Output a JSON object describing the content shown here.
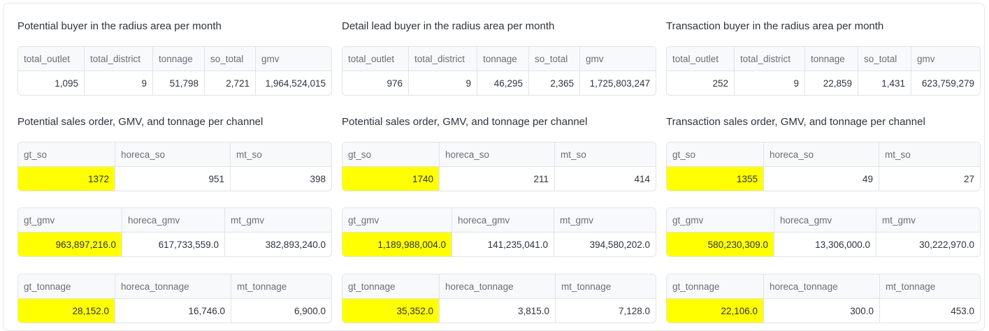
{
  "sections": [
    {
      "summary": {
        "title": "Potential buyer in the radius area per month",
        "headers": [
          "total_outlet",
          "total_district",
          "tonnage",
          "so_total",
          "gmv"
        ],
        "values": [
          "1,095",
          "9",
          "51,798",
          "2,721",
          "1,964,524,015"
        ]
      },
      "channel_title": "Potential sales order, GMV, and tonnage per channel",
      "so": {
        "headers": [
          "gt_so",
          "horeca_so",
          "mt_so"
        ],
        "values": [
          "1372",
          "951",
          "398"
        ]
      },
      "gmv": {
        "headers": [
          "gt_gmv",
          "horeca_gmv",
          "mt_gmv"
        ],
        "values": [
          "963,897,216.0",
          "617,733,559.0",
          "382,893,240.0"
        ]
      },
      "tonnage": {
        "headers": [
          "gt_tonnage",
          "horeca_tonnage",
          "mt_tonnage"
        ],
        "values": [
          "28,152.0",
          "16,746.0",
          "6,900.0"
        ]
      }
    },
    {
      "summary": {
        "title": "Detail lead buyer in the radius area per month",
        "headers": [
          "total_outlet",
          "total_district",
          "tonnage",
          "so_total",
          "gmv"
        ],
        "values": [
          "976",
          "9",
          "46,295",
          "2,365",
          "1,725,803,247"
        ]
      },
      "channel_title": "Potential sales order, GMV, and tonnage per channel",
      "so": {
        "headers": [
          "gt_so",
          "horeca_so",
          "mt_so"
        ],
        "values": [
          "1740",
          "211",
          "414"
        ]
      },
      "gmv": {
        "headers": [
          "gt_gmv",
          "horeca_gmv",
          "mt_gmv"
        ],
        "values": [
          "1,189,988,004.0",
          "141,235,041.0",
          "394,580,202.0"
        ]
      },
      "tonnage": {
        "headers": [
          "gt_tonnage",
          "horeca_tonnage",
          "mt_tonnage"
        ],
        "values": [
          "35,352.0",
          "3,815.0",
          "7,128.0"
        ]
      }
    },
    {
      "summary": {
        "title": "Transaction buyer in the radius area per month",
        "headers": [
          "total_outlet",
          "total_district",
          "tonnage",
          "so_total",
          "gmv"
        ],
        "values": [
          "252",
          "9",
          "22,859",
          "1,431",
          "623,759,279"
        ]
      },
      "channel_title": "Transaction sales order, GMV, and tonnage per channel",
      "so": {
        "headers": [
          "gt_so",
          "horeca_so",
          "mt_so"
        ],
        "values": [
          "1355",
          "49",
          "27"
        ]
      },
      "gmv": {
        "headers": [
          "gt_gmv",
          "horeca_gmv",
          "mt_gmv"
        ],
        "values": [
          "580,230,309.0",
          "13,306,000.0",
          "30,222,970.0"
        ]
      },
      "tonnage": {
        "headers": [
          "gt_tonnage",
          "horeca_tonnage",
          "mt_tonnage"
        ],
        "values": [
          "22,106.0",
          "300.0",
          "453.0"
        ]
      }
    }
  ],
  "highlight_color": "#ffff00"
}
